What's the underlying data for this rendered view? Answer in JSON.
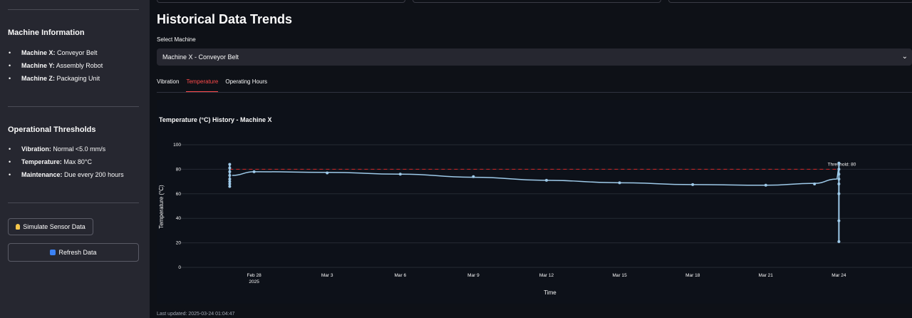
{
  "sidebar": {
    "machine_info": {
      "heading": "Machine Information",
      "items": [
        {
          "key": "Machine X:",
          "value": "Conveyor Belt"
        },
        {
          "key": "Machine Y:",
          "value": "Assembly Robot"
        },
        {
          "key": "Machine Z:",
          "value": "Packaging Unit"
        }
      ]
    },
    "thresholds": {
      "heading": "Operational Thresholds",
      "items": [
        {
          "key": "Vibration:",
          "value": "Normal <5.0 mm/s"
        },
        {
          "key": "Temperature:",
          "value": "Max 80°C"
        },
        {
          "key": "Maintenance:",
          "value": "Due every 200 hours"
        }
      ]
    },
    "simulate_button": "Simulate Sensor Data",
    "refresh_button": "Refresh Data"
  },
  "main": {
    "title": "Historical Data Trends",
    "select_label": "Select Machine",
    "select_value": "Machine X - Conveyor Belt",
    "tabs": [
      "Vibration",
      "Temperature",
      "Operating Hours"
    ],
    "active_tab": "Temperature",
    "footer": "Last updated: 2025-03-24 01:04:47"
  },
  "colors": {
    "accent": "#ff4b4b",
    "series": "#9ecae9",
    "threshold": "#d62728"
  },
  "chart_data": {
    "type": "line",
    "title": "Temperature (°C) History - Machine X",
    "xlabel": "Time",
    "ylabel": "Temperature (°C)",
    "ylim": [
      0,
      100
    ],
    "yticks": [
      0,
      20,
      40,
      60,
      80,
      100
    ],
    "xticks": [
      "Feb 28\n2025",
      "Mar 3",
      "Mar 6",
      "Mar 9",
      "Mar 12",
      "Mar 15",
      "Mar 18",
      "Mar 21",
      "Mar 24"
    ],
    "threshold": {
      "value": 80,
      "label": "Threshold: 80"
    },
    "series": [
      {
        "x": [
          "2025-02-27",
          "2025-02-27",
          "2025-02-27",
          "2025-02-27",
          "2025-02-27",
          "2025-02-27",
          "2025-02-27",
          "2025-02-27",
          "2025-02-28",
          "2025-03-03",
          "2025-03-06",
          "2025-03-09",
          "2025-03-12",
          "2025-03-15",
          "2025-03-18",
          "2025-03-21",
          "2025-03-23",
          "2025-03-24",
          "2025-03-24",
          "2025-03-24",
          "2025-03-24",
          "2025-03-24",
          "2025-03-24",
          "2025-03-24",
          "2025-03-24"
        ],
        "y": [
          66,
          68,
          70,
          72,
          75,
          78,
          81,
          84,
          78,
          77,
          76,
          74,
          71,
          69,
          67.5,
          67,
          68,
          72,
          80,
          85,
          76,
          68,
          60,
          38,
          21
        ]
      }
    ],
    "grid": true
  }
}
